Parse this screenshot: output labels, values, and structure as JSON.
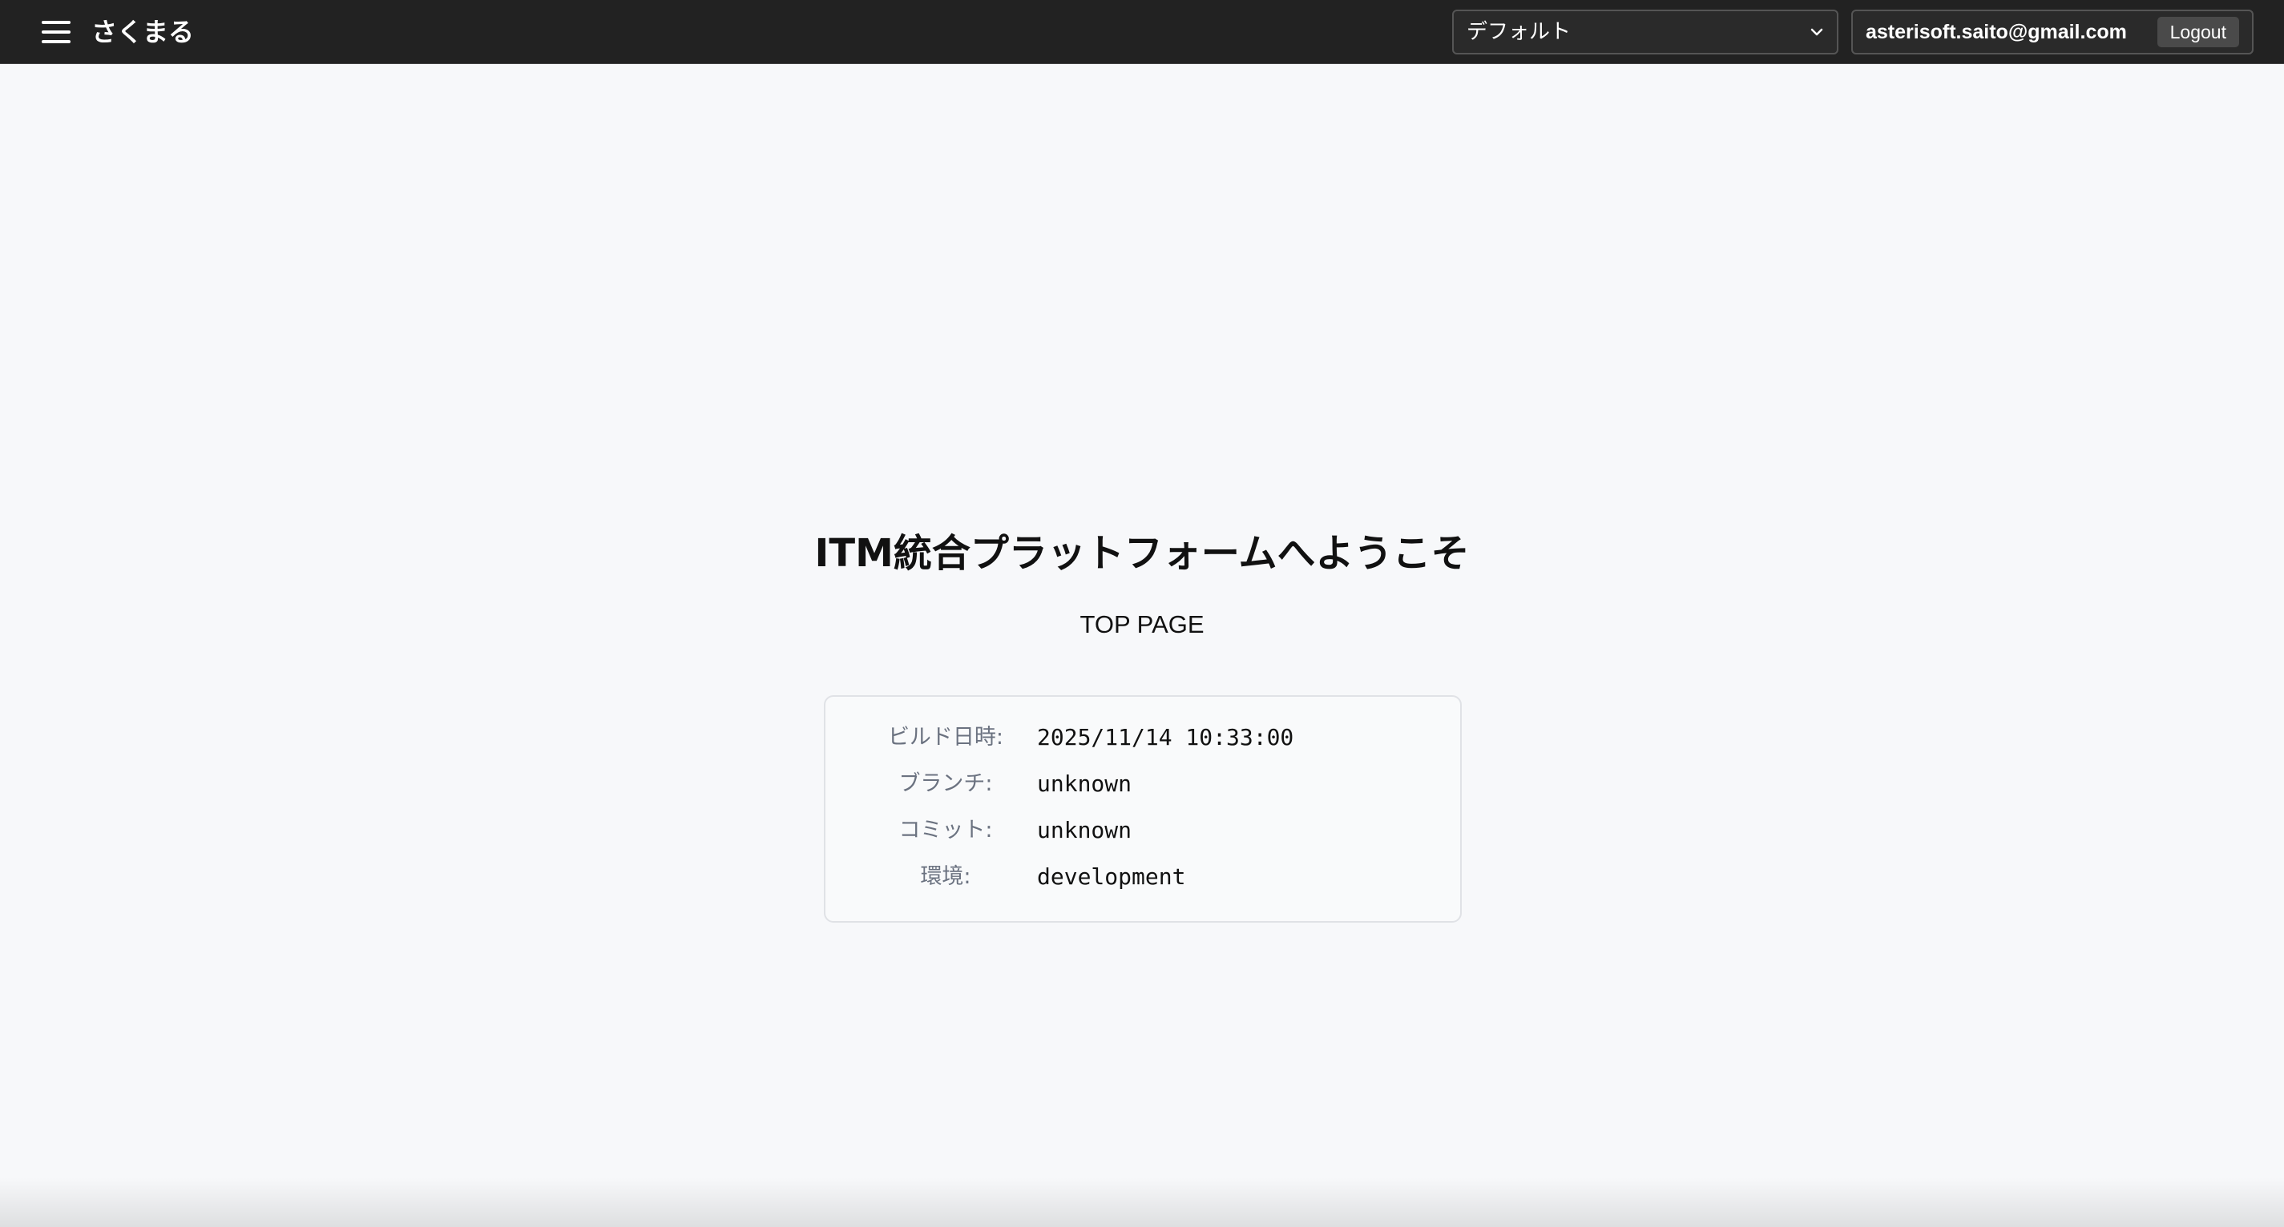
{
  "header": {
    "app_title": "さくまる",
    "menu_icon": "hamburger-menu-icon",
    "group_select": {
      "selected": "デフォルト",
      "icon": "chevron-down-icon"
    },
    "user": {
      "email": "asterisoft.saito@gmail.com",
      "logout_label": "Logout"
    }
  },
  "main": {
    "welcome_title": "ITM統合プラットフォームへようこそ",
    "subtitle": "TOP PAGE",
    "build_info": [
      {
        "label": "ビルド日時:",
        "value": "2025/11/14 10:33:00"
      },
      {
        "label": "ブランチ:",
        "value": "unknown"
      },
      {
        "label": "コミット:",
        "value": "unknown"
      },
      {
        "label": "環境:",
        "value": "development"
      }
    ]
  }
}
